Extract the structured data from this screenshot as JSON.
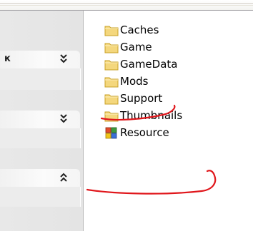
{
  "taskpane": {
    "groups": [
      {
        "title_fragment": "к",
        "expanded": false
      },
      {
        "title_fragment": "",
        "expanded": false
      },
      {
        "title_fragment": "",
        "expanded": true
      }
    ]
  },
  "folders": [
    {
      "name": "Caches",
      "icon": "folder-icon"
    },
    {
      "name": "Game",
      "icon": "folder-icon"
    },
    {
      "name": "GameData",
      "icon": "folder-icon"
    },
    {
      "name": "Mods",
      "icon": "folder-icon"
    },
    {
      "name": "Support",
      "icon": "folder-icon"
    },
    {
      "name": "Thumbnails",
      "icon": "folder-icon"
    },
    {
      "name": "Resource",
      "icon": "resource-file-icon"
    }
  ],
  "annotation_color": "#e0161b",
  "colors": {
    "folder_fill": "#f4d77d",
    "folder_edge": "#c9a227",
    "window_bg": "#ffffff"
  }
}
